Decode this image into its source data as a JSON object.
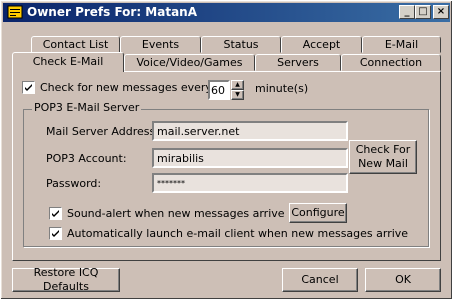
{
  "window": {
    "title": "Owner Prefs For: MatanA"
  },
  "tabs_row1": [
    "Contact List",
    "Events",
    "Status",
    "Accept",
    "E-Mail"
  ],
  "tabs_row2": [
    "Check E-Mail",
    "Voice/Video/Games",
    "Servers",
    "Connection"
  ],
  "check_every": {
    "label": "Check for new messages every",
    "value": "60",
    "unit": "minute(s)",
    "checked": true
  },
  "pop3": {
    "group_label": "POP3 E-Mail Server",
    "server_label": "Mail Server Address:",
    "server_value": "mail.server.net",
    "account_label": "POP3 Account:",
    "account_value": "mirabilis",
    "password_label": "Password:",
    "password_value": "*******",
    "check_button": "Check For New Mail"
  },
  "sound_alert": {
    "label": "Sound-alert when new messages arrive",
    "checked": true
  },
  "configure_button": "Configure",
  "auto_launch": {
    "label": "Automatically launch e-mail client when new messages arrive",
    "checked": true
  },
  "buttons": {
    "restore": "Restore ICQ Defaults",
    "cancel": "Cancel",
    "ok": "OK"
  }
}
